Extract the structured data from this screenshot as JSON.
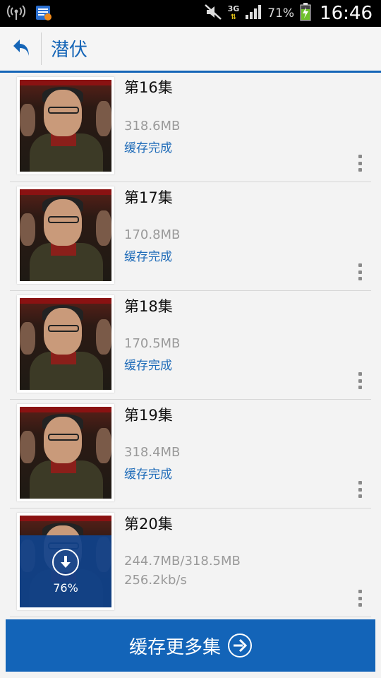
{
  "status_bar": {
    "network_type": "3G",
    "battery_percent": "71%",
    "time": "16:46"
  },
  "app_bar": {
    "title": "潜伏",
    "accent_color": "#1565b7"
  },
  "episodes": [
    {
      "title": "第16集",
      "size": "318.6MB",
      "status": "缓存完成"
    },
    {
      "title": "第17集",
      "size": "170.8MB",
      "status": "缓存完成"
    },
    {
      "title": "第18集",
      "size": "170.5MB",
      "status": "缓存完成"
    },
    {
      "title": "第19集",
      "size": "318.4MB",
      "status": "缓存完成"
    },
    {
      "title": "第20集",
      "size": "244.7MB/318.5MB",
      "status": "256.2kb/s",
      "progress": "76%"
    }
  ],
  "footer": {
    "button_label": "缓存更多集"
  }
}
